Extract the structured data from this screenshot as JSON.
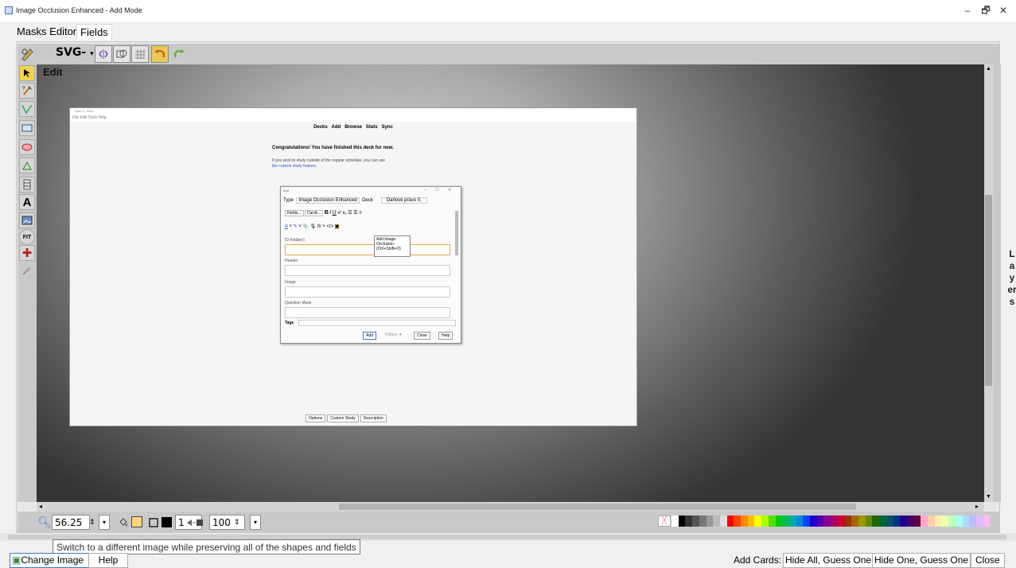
{
  "window": {
    "title": "Image Occlusion Enhanced - Add Mode",
    "minimize": "–",
    "maximize": "🗗",
    "close": "✕"
  },
  "tabs": [
    "Masks Editor",
    "Fields"
  ],
  "toolbar": {
    "svg_menu": "SVG-"
  },
  "canvas": {
    "mode_label": "Edit",
    "layers_label": "Layers"
  },
  "bottom_toolbar": {
    "zoom_value": "56.25",
    "stroke_width": "1",
    "opacity_value": "100"
  },
  "tooltip": "Switch to a different image while preserving all of the shapes and fields",
  "buttons": {
    "change_image": "Change Image",
    "help": "Help",
    "add_cards_label": "Add Cards:",
    "hide_all": "Hide All, Guess One",
    "hide_one": "Hide One, Guess One",
    "close": "Close"
  },
  "embedded_screenshot": {
    "title": "User 1 - Anki",
    "menu": "File  Edit  Tools  Help",
    "nav": [
      "Decks",
      "Add",
      "Browse",
      "Stats",
      "Sync"
    ],
    "congrats": "Congratulations! You have finished this deck for now.",
    "study_line1": "If you wish to study outside of the regular schedule, you can use",
    "study_line2": "the custom study feature.",
    "bottom_buttons": [
      "Options",
      "Custom Study",
      "Description"
    ],
    "add_dialog": {
      "title": "Add",
      "type_label": "Type",
      "type_value": "Image Occlusion Enhanced",
      "deck_label": "Deck",
      "deck_value": "Daňové právo II.",
      "fields_btn": "Fields...",
      "cards_btn": "Cards...",
      "field_labels": [
        "ID (hidden)",
        "Header",
        "Image",
        "Question Mask"
      ],
      "tags_label": "Tags",
      "tooltip": "Add Image Occlusion (Ctrl+Shift+O)",
      "add_btn": "Add",
      "history_btn": "History ▼",
      "close_btn": "Close",
      "help_btn": "Help"
    }
  },
  "palette_colors": [
    "#ffffff",
    "#000000",
    "#333333",
    "#555555",
    "#777777",
    "#999999",
    "#bbbbbb",
    "#dddddd",
    "#ff0000",
    "#ff4400",
    "#ff8800",
    "#ffbb00",
    "#ffff00",
    "#aaff00",
    "#55dd00",
    "#00cc00",
    "#00bb55",
    "#00aaaa",
    "#0088dd",
    "#0044ff",
    "#2200cc",
    "#5500aa",
    "#880099",
    "#aa0066",
    "#cc0033",
    "#993300",
    "#aa6600",
    "#999900",
    "#668800",
    "#226600",
    "#006633",
    "#005566",
    "#003388",
    "#220088",
    "#440066",
    "#660044",
    "#ffaacc",
    "#ffccaa",
    "#ffeeaa",
    "#eeffaa",
    "#bbffbb",
    "#aaffee",
    "#aaddff",
    "#bbbbff",
    "#ddbbff",
    "#ffbbee"
  ]
}
